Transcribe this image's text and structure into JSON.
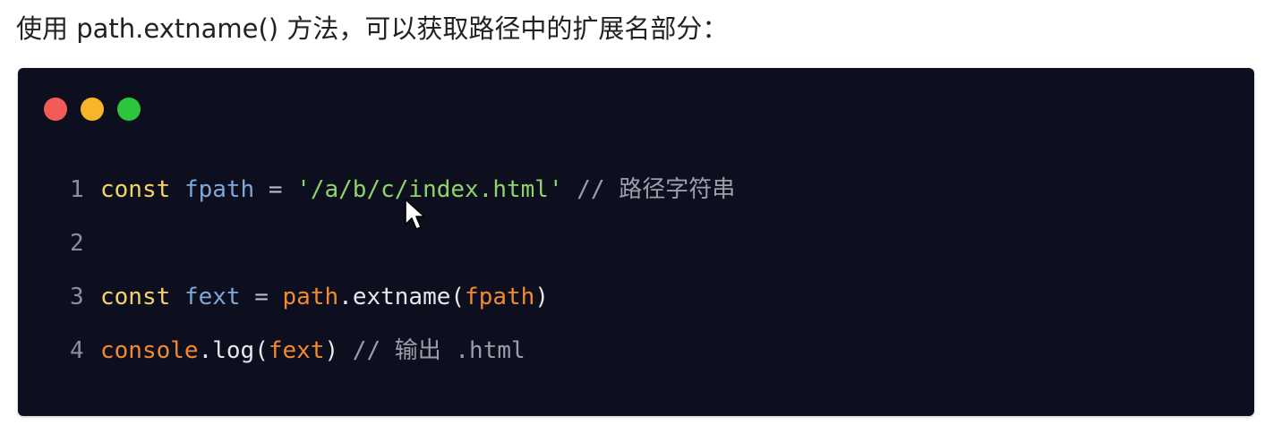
{
  "intro_text": "使用 path.extname() 方法，可以获取路径中的扩展名部分：",
  "window_dots": {
    "red": "#f25b57",
    "yellow": "#f7b52c",
    "green": "#2bc63e"
  },
  "code": {
    "background": "#0d0f1e",
    "lines": [
      {
        "number": "1",
        "tokens": {
          "kw": "const",
          "sp1": " ",
          "var": "fpath",
          "op": " = ",
          "str": "'/a/b/c/index.html'",
          "cmt": " // 路径字符串"
        }
      },
      {
        "number": "2"
      },
      {
        "number": "3",
        "tokens": {
          "kw": "const",
          "sp1": " ",
          "var": "fext",
          "op": " = ",
          "obj": "path",
          "dot": ".",
          "method": "extname",
          "p1": "(",
          "arg": "fpath",
          "p2": ")"
        }
      },
      {
        "number": "4",
        "tokens": {
          "obj": "console",
          "dot": ".",
          "method": "log",
          "p1": "(",
          "arg": "fext",
          "p2": ")",
          "cmt": " // 输出 .html"
        }
      }
    ]
  }
}
